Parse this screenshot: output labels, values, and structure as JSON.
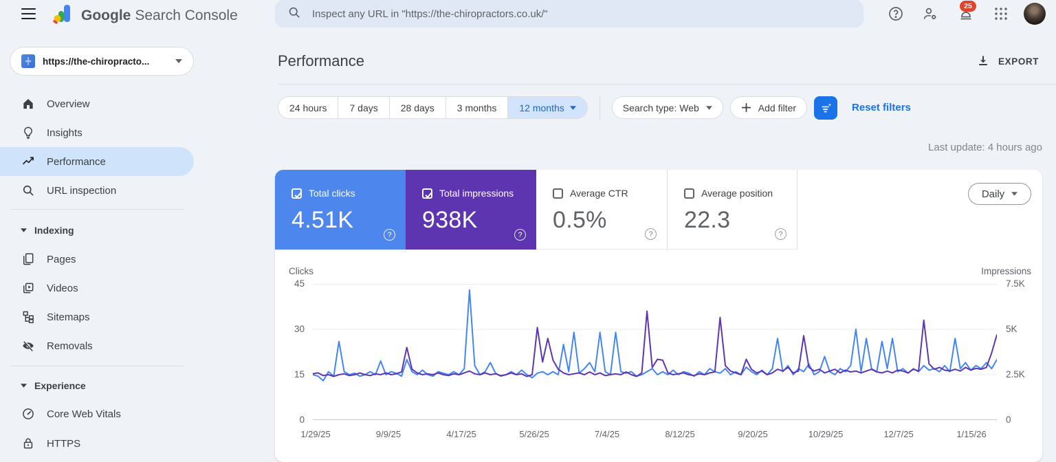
{
  "topbar": {
    "brand": "Google",
    "product": "Search Console",
    "search_placeholder": "Inspect any URL in \"https://the-chiropractors.co.uk/\"",
    "notification_count": "25",
    "icons": [
      "menu-icon",
      "help-icon",
      "manage-users-icon",
      "notifications-icon",
      "apps-grid-icon",
      "avatar"
    ]
  },
  "sidebar": {
    "property": "https://the-chiropracto...",
    "items": [
      {
        "label": "Overview",
        "icon": "home-icon"
      },
      {
        "label": "Insights",
        "icon": "lightbulb-icon"
      },
      {
        "label": "Performance",
        "icon": "trending-up-icon",
        "selected": true
      },
      {
        "label": "URL inspection",
        "icon": "search-icon"
      }
    ],
    "sections": [
      {
        "label": "Indexing",
        "items": [
          {
            "label": "Pages",
            "icon": "pages-icon"
          },
          {
            "label": "Videos",
            "icon": "video-icon"
          },
          {
            "label": "Sitemaps",
            "icon": "sitemap-icon"
          },
          {
            "label": "Removals",
            "icon": "eye-off-icon"
          }
        ]
      },
      {
        "label": "Experience",
        "items": [
          {
            "label": "Core Web Vitals",
            "icon": "speedometer-icon"
          },
          {
            "label": "HTTPS",
            "icon": "lock-icon"
          }
        ]
      }
    ]
  },
  "header": {
    "title": "Performance",
    "export_label": "EXPORT",
    "last_update": "Last update: 4 hours ago"
  },
  "toolbar": {
    "date_ranges": [
      "24 hours",
      "7 days",
      "28 days",
      "3 months",
      "12 months"
    ],
    "selected_range": "12 months",
    "search_type": "Search type: Web",
    "add_filter": "Add filter",
    "reset_filters": "Reset filters"
  },
  "metrics": {
    "granularity": "Daily",
    "cards": [
      {
        "label": "Total clicks",
        "value": "4.51K",
        "selected": true,
        "color": "#4d87ee"
      },
      {
        "label": "Total impressions",
        "value": "938K",
        "selected": true,
        "color": "#5e35b1"
      },
      {
        "label": "Average CTR",
        "value": "0.5%",
        "selected": false,
        "color": "#ffffff"
      },
      {
        "label": "Average position",
        "value": "22.3",
        "selected": false,
        "color": "#ffffff"
      }
    ]
  },
  "colors": {
    "link_blue": "#1a73e8",
    "selected_chip": "#d2e3fc",
    "sidebar_selected": "#cfe4fb",
    "badge_red": "#e0442e"
  },
  "chart_data": {
    "type": "line",
    "title": "Clicks and impressions over time (12 months, daily)",
    "x_labels": [
      "1/29/25",
      "9/9/25",
      "4/17/25",
      "5/26/25",
      "7/4/25",
      "8/12/25",
      "9/20/25",
      "10/29/25",
      "12/7/25",
      "1/15/26"
    ],
    "left_axis": {
      "label": "Clicks",
      "ticks": [
        0,
        15,
        30,
        45
      ],
      "range": [
        0,
        45
      ]
    },
    "right_axis": {
      "label": "Impressions",
      "ticks": [
        0,
        2500,
        5000,
        7500
      ],
      "tick_labels": [
        "0",
        "2.5K",
        "5K",
        "7.5K"
      ],
      "range": [
        0,
        7500
      ]
    },
    "grid": true,
    "legend_position": "none",
    "series": [
      {
        "name": "Clicks",
        "axis": "left",
        "color": "#4285f4",
        "values": [
          15,
          14.5,
          13,
          16,
          14.5,
          26,
          16,
          15,
          15.5,
          14.5,
          15,
          16,
          15,
          19.5,
          15,
          16,
          15.5,
          14.5,
          20,
          16,
          15,
          16.5,
          15,
          14.5,
          16,
          15.5,
          15,
          16,
          15,
          17,
          43,
          18,
          15,
          16,
          19,
          15.5,
          14.5,
          15,
          16,
          15,
          16.5,
          15,
          14,
          15.5,
          16,
          15,
          16,
          15,
          25,
          16,
          29,
          15.5,
          17,
          19,
          16,
          29,
          16,
          15,
          29,
          16,
          15.5,
          16,
          14.5,
          15,
          16,
          17,
          15,
          16,
          15,
          16.5,
          15,
          16,
          15.5,
          14.5,
          16,
          15,
          17,
          16,
          15.5,
          17,
          15,
          16,
          15,
          17.5,
          16,
          15,
          16.5,
          15,
          17,
          27,
          16,
          18,
          15,
          17,
          16,
          18.5,
          15,
          16,
          21,
          16,
          15,
          17,
          16,
          18,
          30,
          16,
          27,
          17,
          16,
          26,
          17,
          27,
          16,
          17,
          15.5,
          17,
          16,
          18,
          16.5,
          17,
          16,
          18,
          16,
          27,
          17,
          19,
          16.5,
          18,
          17,
          19,
          17,
          20
        ]
      },
      {
        "name": "Impressions",
        "axis": "right",
        "color": "#5e35b1",
        "values": [
          2550,
          2600,
          2450,
          2500,
          2400,
          2500,
          2550,
          2450,
          2500,
          2600,
          2500,
          2450,
          2550,
          2500,
          2600,
          2500,
          2550,
          2650,
          4000,
          2800,
          2600,
          2500,
          2550,
          2500,
          2600,
          2500,
          2450,
          2550,
          2500,
          2600,
          2700,
          2550,
          2500,
          2600,
          2500,
          2550,
          2450,
          2500,
          2600,
          2500,
          2550,
          2400,
          2500,
          5100,
          3200,
          4500,
          3300,
          2800,
          2600,
          2500,
          2550,
          2600,
          2500,
          2650,
          2500,
          2600,
          2450,
          2500,
          2550,
          2500,
          2650,
          2500,
          2400,
          2600,
          6000,
          2900,
          3350,
          3300,
          2600,
          2500,
          2550,
          2600,
          2500,
          2450,
          2550,
          2500,
          2600,
          2650,
          5650,
          3000,
          2700,
          2600,
          2500,
          3350,
          2800,
          2600,
          2700,
          2500,
          2600,
          2800,
          2700,
          2900,
          2600,
          2700,
          4650,
          2900,
          2700,
          2800,
          2600,
          2700,
          2800,
          2600,
          2750,
          2650,
          2700,
          2600,
          2700,
          2800,
          2650,
          2600,
          2700,
          2600,
          2750,
          2700,
          2600,
          2800,
          2700,
          5500,
          3100,
          2800,
          2900,
          2750,
          2700,
          2800,
          2700,
          2900,
          2750,
          2850,
          2800,
          2900,
          3700,
          4700
        ]
      }
    ]
  }
}
